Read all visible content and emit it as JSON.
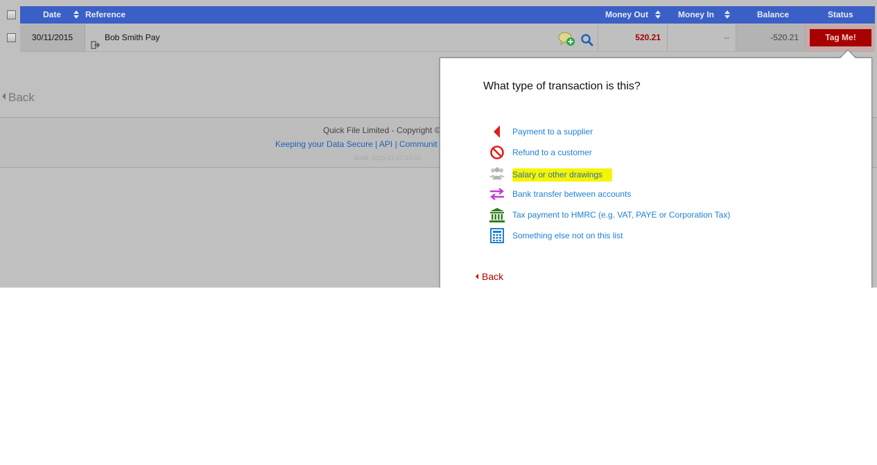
{
  "table": {
    "headers": {
      "date": "Date",
      "reference": "Reference",
      "money_out": "Money Out",
      "money_in": "Money In",
      "balance": "Balance",
      "status": "Status"
    },
    "rows": [
      {
        "date": "30/11/2015",
        "reference": "Bob Smith Pay",
        "money_out": "520.21",
        "money_in": "--",
        "balance": "-520.21",
        "status_button": "Tag Me!"
      }
    ]
  },
  "back_label": "Back",
  "footer": {
    "copyright": "Quick File Limited - Copyright ©",
    "link_data_secure": "Keeping your Data Secure",
    "link_api": "API",
    "link_community": "Communit",
    "separator": " | ",
    "build": "Build: 2015-11-27-10-20"
  },
  "popover": {
    "question": "What type of transaction is this?",
    "options": [
      {
        "label": "Payment to a supplier",
        "icon": "left-arrow-icon",
        "color": "#e11c1c"
      },
      {
        "label": "Refund to a customer",
        "icon": "no-entry-icon",
        "color": "#e11c1c"
      },
      {
        "label": "Salary or other drawings",
        "icon": "people-icon",
        "color": "#bdbdbd",
        "highlighted": true
      },
      {
        "label": "Bank transfer between accounts",
        "icon": "transfer-arrows-icon",
        "color": "#c43ad6"
      },
      {
        "label": "Tax payment to HMRC (e.g. VAT, PAYE or Corporation Tax)",
        "icon": "bank-building-icon",
        "color": "#2e7d1f"
      },
      {
        "label": "Something else not on this list",
        "icon": "calculator-icon",
        "color": "#1d7fd6"
      }
    ],
    "back_label": "Back"
  },
  "colors": {
    "header_bg": "#3a5fc6",
    "tag_button": "#a80000",
    "highlight": "#f5f500",
    "link": "#1d7fd6"
  }
}
